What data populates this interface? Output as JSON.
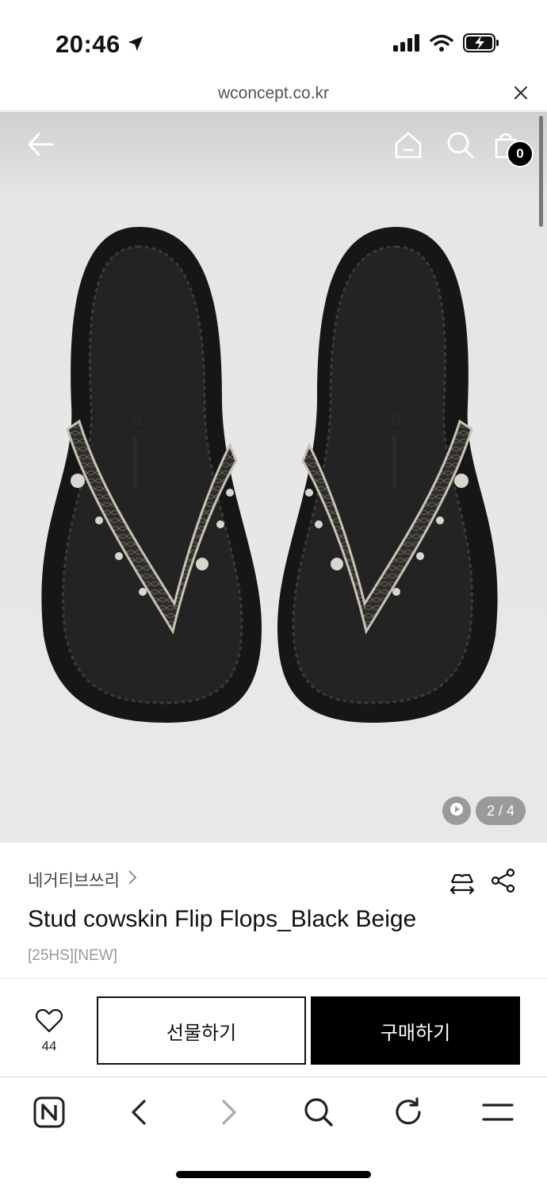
{
  "status": {
    "time": "20:46"
  },
  "browser": {
    "url": "wconcept.co.kr"
  },
  "header": {
    "cart_count": "0"
  },
  "gallery": {
    "counter": "2 / 4"
  },
  "product": {
    "brand": "네거티브쓰리",
    "title": "Stud cowskin Flip Flops_Black Beige",
    "tag": "[25HS][NEW]"
  },
  "actions": {
    "wish_count": "44",
    "gift_label": "선물하기",
    "buy_label": "구매하기"
  },
  "icons": [
    "location-arrow-icon",
    "signal-icon",
    "wifi-icon",
    "battery-icon",
    "close-icon",
    "back-arrow-icon",
    "home-icon",
    "search-icon",
    "shopping-bag-icon",
    "play-icon",
    "size-icon",
    "share-icon",
    "heart-icon",
    "naver-icon",
    "chevron-left-icon",
    "chevron-right-icon",
    "reload-icon",
    "menu-icon"
  ]
}
